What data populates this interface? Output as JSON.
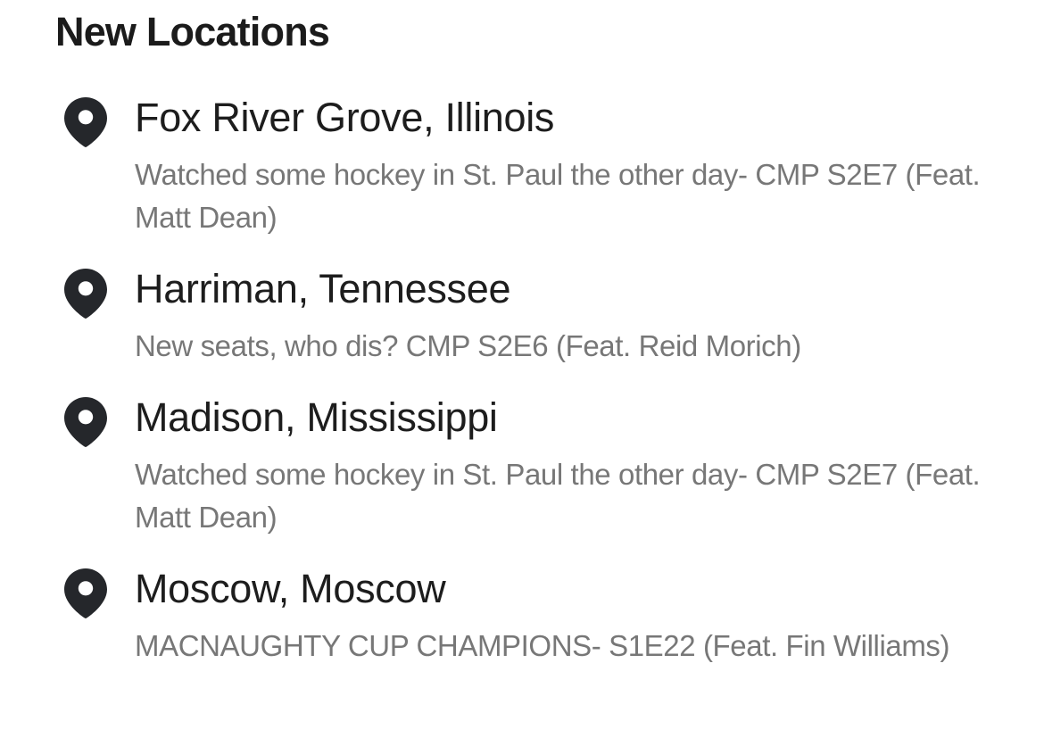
{
  "section": {
    "title": "New Locations"
  },
  "locations": [
    {
      "name": "Fox River Grove, Illinois",
      "description": "Watched some hockey in St. Paul the other day- CMP S2E7 (Feat. Matt Dean)",
      "icon": "map-pin-icon"
    },
    {
      "name": "Harriman, Tennessee",
      "description": "New seats, who dis? CMP S2E6 (Feat. Reid Morich)",
      "icon": "map-pin-icon"
    },
    {
      "name": "Madison, Mississippi",
      "description": "Watched some hockey in St. Paul the other day- CMP S2E7 (Feat. Matt Dean)",
      "icon": "map-pin-icon"
    },
    {
      "name": "Moscow, Moscow",
      "description": "MACNAUGHTY CUP CHAMPIONS- S1E22 (Feat. Fin Williams)",
      "icon": "map-pin-icon"
    }
  ],
  "colors": {
    "title_text": "#1b1b1b",
    "name_text": "#1d1d1d",
    "description_text": "#777777",
    "pin_fill": "#25272b",
    "background": "#ffffff"
  }
}
